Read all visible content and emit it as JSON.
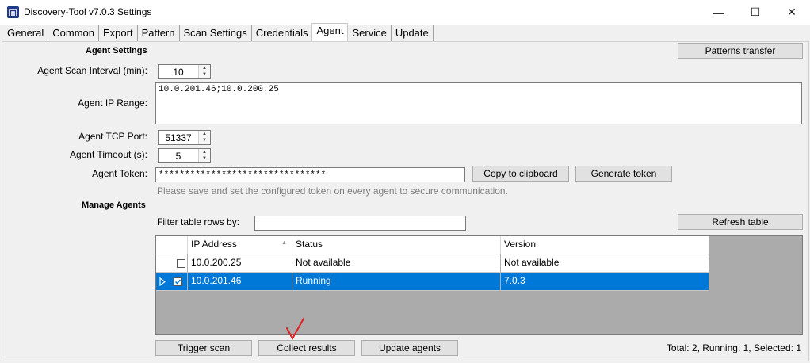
{
  "window": {
    "title": "Discovery-Tool v7.0.3 Settings",
    "minimize": "—",
    "maximize": "☐",
    "close": "✕"
  },
  "tabs": [
    {
      "label": "General"
    },
    {
      "label": "Common"
    },
    {
      "label": "Export"
    },
    {
      "label": "Pattern"
    },
    {
      "label": "Scan Settings"
    },
    {
      "label": "Credentials"
    },
    {
      "label": "Agent"
    },
    {
      "label": "Service"
    },
    {
      "label": "Update"
    }
  ],
  "agent_settings": {
    "section_label": "Agent Settings",
    "patterns_button": "Patterns transfer",
    "scan_interval_label": "Agent Scan Interval (min):",
    "scan_interval_value": "10",
    "ip_range_label": "Agent IP Range:",
    "ip_range_value": "10.0.201.46;10.0.200.25",
    "tcp_port_label": "Agent TCP Port:",
    "tcp_port_value": "51337",
    "timeout_label": "Agent Timeout (s):",
    "timeout_value": "5",
    "token_label": "Agent Token:",
    "token_value": "********************************",
    "copy_button": "Copy to clipboard",
    "generate_button": "Generate token",
    "token_hint": "Please save and set the configured token on every agent to secure communication."
  },
  "manage_agents": {
    "section_label": "Manage Agents",
    "filter_label": "Filter table rows by:",
    "filter_value": "",
    "refresh_button": "Refresh table",
    "columns": [
      "IP Address",
      "Status",
      "Version"
    ],
    "sort_indicator": "▲",
    "rows": [
      {
        "ip": "10.0.200.25",
        "status": "Not available",
        "version": "Not available",
        "checked": false,
        "selected": false
      },
      {
        "ip": "10.0.201.46",
        "status": "Running",
        "version": "7.0.3",
        "checked": true,
        "selected": true
      }
    ],
    "trigger_button": "Trigger scan",
    "collect_button": "Collect results",
    "update_button": "Update agents",
    "summary": "Total: 2, Running: 1, Selected: 1"
  },
  "colors": {
    "selection": "#0078d7",
    "annotation": "#e02020"
  }
}
